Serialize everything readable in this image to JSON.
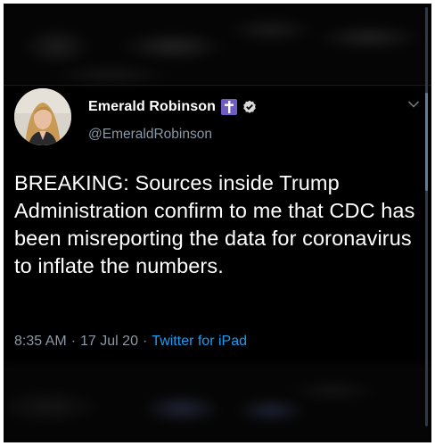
{
  "tweet": {
    "display_name": "Emerald Robinson",
    "name_emoji": "✝",
    "handle": "@EmeraldRobinson",
    "text": "BREAKING: Sources inside Trump Administration confirm to me that CDC has been misreporting the data for coronavirus to inflate the numbers.",
    "time": "8:35 AM",
    "separator": "·",
    "date": "17 Jul 20",
    "source": "Twitter for iPad"
  },
  "icons": {
    "cross": "latin-cross-emoji",
    "verified": "verified-badge-icon",
    "chevron": "chevron-down-icon"
  },
  "colors": {
    "background": "#000000",
    "primary_text": "#ffffff",
    "secondary_text": "#8b98a5",
    "link": "#1d9bf0",
    "cross_badge": "#6f5cc2"
  }
}
